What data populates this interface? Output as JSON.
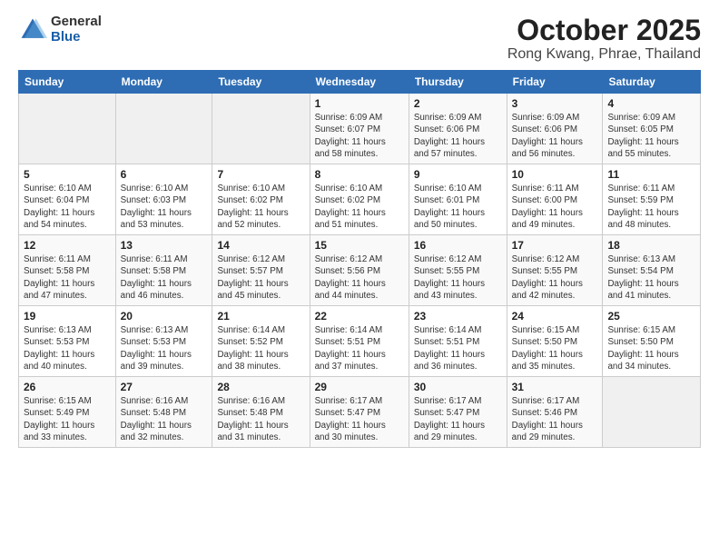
{
  "header": {
    "logo_general": "General",
    "logo_blue": "Blue",
    "title": "October 2025",
    "location": "Rong Kwang, Phrae, Thailand"
  },
  "weekdays": [
    "Sunday",
    "Monday",
    "Tuesday",
    "Wednesday",
    "Thursday",
    "Friday",
    "Saturday"
  ],
  "weeks": [
    [
      {
        "day": "",
        "info": ""
      },
      {
        "day": "",
        "info": ""
      },
      {
        "day": "",
        "info": ""
      },
      {
        "day": "1",
        "info": "Sunrise: 6:09 AM\nSunset: 6:07 PM\nDaylight: 11 hours\nand 58 minutes."
      },
      {
        "day": "2",
        "info": "Sunrise: 6:09 AM\nSunset: 6:06 PM\nDaylight: 11 hours\nand 57 minutes."
      },
      {
        "day": "3",
        "info": "Sunrise: 6:09 AM\nSunset: 6:06 PM\nDaylight: 11 hours\nand 56 minutes."
      },
      {
        "day": "4",
        "info": "Sunrise: 6:09 AM\nSunset: 6:05 PM\nDaylight: 11 hours\nand 55 minutes."
      }
    ],
    [
      {
        "day": "5",
        "info": "Sunrise: 6:10 AM\nSunset: 6:04 PM\nDaylight: 11 hours\nand 54 minutes."
      },
      {
        "day": "6",
        "info": "Sunrise: 6:10 AM\nSunset: 6:03 PM\nDaylight: 11 hours\nand 53 minutes."
      },
      {
        "day": "7",
        "info": "Sunrise: 6:10 AM\nSunset: 6:02 PM\nDaylight: 11 hours\nand 52 minutes."
      },
      {
        "day": "8",
        "info": "Sunrise: 6:10 AM\nSunset: 6:02 PM\nDaylight: 11 hours\nand 51 minutes."
      },
      {
        "day": "9",
        "info": "Sunrise: 6:10 AM\nSunset: 6:01 PM\nDaylight: 11 hours\nand 50 minutes."
      },
      {
        "day": "10",
        "info": "Sunrise: 6:11 AM\nSunset: 6:00 PM\nDaylight: 11 hours\nand 49 minutes."
      },
      {
        "day": "11",
        "info": "Sunrise: 6:11 AM\nSunset: 5:59 PM\nDaylight: 11 hours\nand 48 minutes."
      }
    ],
    [
      {
        "day": "12",
        "info": "Sunrise: 6:11 AM\nSunset: 5:58 PM\nDaylight: 11 hours\nand 47 minutes."
      },
      {
        "day": "13",
        "info": "Sunrise: 6:11 AM\nSunset: 5:58 PM\nDaylight: 11 hours\nand 46 minutes."
      },
      {
        "day": "14",
        "info": "Sunrise: 6:12 AM\nSunset: 5:57 PM\nDaylight: 11 hours\nand 45 minutes."
      },
      {
        "day": "15",
        "info": "Sunrise: 6:12 AM\nSunset: 5:56 PM\nDaylight: 11 hours\nand 44 minutes."
      },
      {
        "day": "16",
        "info": "Sunrise: 6:12 AM\nSunset: 5:55 PM\nDaylight: 11 hours\nand 43 minutes."
      },
      {
        "day": "17",
        "info": "Sunrise: 6:12 AM\nSunset: 5:55 PM\nDaylight: 11 hours\nand 42 minutes."
      },
      {
        "day": "18",
        "info": "Sunrise: 6:13 AM\nSunset: 5:54 PM\nDaylight: 11 hours\nand 41 minutes."
      }
    ],
    [
      {
        "day": "19",
        "info": "Sunrise: 6:13 AM\nSunset: 5:53 PM\nDaylight: 11 hours\nand 40 minutes."
      },
      {
        "day": "20",
        "info": "Sunrise: 6:13 AM\nSunset: 5:53 PM\nDaylight: 11 hours\nand 39 minutes."
      },
      {
        "day": "21",
        "info": "Sunrise: 6:14 AM\nSunset: 5:52 PM\nDaylight: 11 hours\nand 38 minutes."
      },
      {
        "day": "22",
        "info": "Sunrise: 6:14 AM\nSunset: 5:51 PM\nDaylight: 11 hours\nand 37 minutes."
      },
      {
        "day": "23",
        "info": "Sunrise: 6:14 AM\nSunset: 5:51 PM\nDaylight: 11 hours\nand 36 minutes."
      },
      {
        "day": "24",
        "info": "Sunrise: 6:15 AM\nSunset: 5:50 PM\nDaylight: 11 hours\nand 35 minutes."
      },
      {
        "day": "25",
        "info": "Sunrise: 6:15 AM\nSunset: 5:50 PM\nDaylight: 11 hours\nand 34 minutes."
      }
    ],
    [
      {
        "day": "26",
        "info": "Sunrise: 6:15 AM\nSunset: 5:49 PM\nDaylight: 11 hours\nand 33 minutes."
      },
      {
        "day": "27",
        "info": "Sunrise: 6:16 AM\nSunset: 5:48 PM\nDaylight: 11 hours\nand 32 minutes."
      },
      {
        "day": "28",
        "info": "Sunrise: 6:16 AM\nSunset: 5:48 PM\nDaylight: 11 hours\nand 31 minutes."
      },
      {
        "day": "29",
        "info": "Sunrise: 6:17 AM\nSunset: 5:47 PM\nDaylight: 11 hours\nand 30 minutes."
      },
      {
        "day": "30",
        "info": "Sunrise: 6:17 AM\nSunset: 5:47 PM\nDaylight: 11 hours\nand 29 minutes."
      },
      {
        "day": "31",
        "info": "Sunrise: 6:17 AM\nSunset: 5:46 PM\nDaylight: 11 hours\nand 29 minutes."
      },
      {
        "day": "",
        "info": ""
      }
    ]
  ]
}
